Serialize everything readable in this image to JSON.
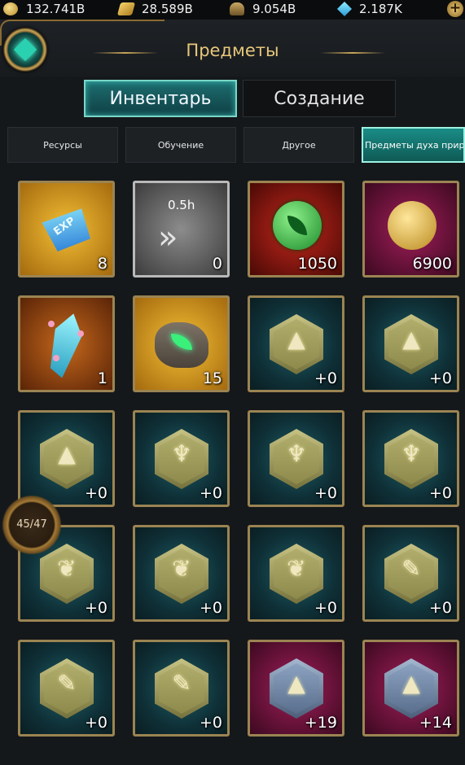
{
  "resources": [
    {
      "icon": "coin-icon",
      "value": "132.741B"
    },
    {
      "icon": "bread-icon",
      "value": "28.589B"
    },
    {
      "icon": "helmet-icon",
      "value": "9.054B"
    },
    {
      "icon": "diamond-icon",
      "value": "2.187K"
    }
  ],
  "header": {
    "title": "Предметы",
    "add_symbol": "+"
  },
  "tabs": {
    "inventory": "Инвентарь",
    "crafting": "Создание"
  },
  "subtabs": [
    "Ресурсы",
    "Обучение",
    "Другое",
    "Предметы духа природы"
  ],
  "capacity": "45/47",
  "items": [
    {
      "name": "exp-crystal",
      "bg": "gold",
      "count": "8",
      "label": "EXP"
    },
    {
      "name": "speedup-0-5h",
      "bg": "grey",
      "count": "0",
      "label": "0.5h"
    },
    {
      "name": "nature-coin-green",
      "bg": "red",
      "count": "1050"
    },
    {
      "name": "tree-coin-gold",
      "bg": "magenta",
      "count": "6900"
    },
    {
      "name": "crystal-flower",
      "bg": "orange",
      "count": "1"
    },
    {
      "name": "leaf-stone",
      "bg": "gold",
      "count": "15"
    },
    {
      "name": "mountain-rune",
      "bg": "teal",
      "count": "+0"
    },
    {
      "name": "mountain-rune",
      "bg": "teal",
      "count": "+0"
    },
    {
      "name": "mountain-rune",
      "bg": "teal",
      "count": "+0"
    },
    {
      "name": "sprout-rune",
      "bg": "teal",
      "count": "+0"
    },
    {
      "name": "sprout-rune",
      "bg": "teal",
      "count": "+0"
    },
    {
      "name": "sprout-rune",
      "bg": "teal",
      "count": "+0"
    },
    {
      "name": "leaf-rune",
      "bg": "teal",
      "count": "+0"
    },
    {
      "name": "leaf-rune",
      "bg": "teal",
      "count": "+0"
    },
    {
      "name": "leaf-rune",
      "bg": "teal",
      "count": "+0"
    },
    {
      "name": "feather-rune",
      "bg": "teal",
      "count": "+0"
    },
    {
      "name": "feather-rune",
      "bg": "teal",
      "count": "+0"
    },
    {
      "name": "feather-rune",
      "bg": "teal",
      "count": "+0"
    },
    {
      "name": "mountain-rune-ii",
      "bg": "magenta",
      "count": "+19"
    },
    {
      "name": "mountain-rune-ii",
      "bg": "magenta",
      "count": "+14"
    }
  ]
}
